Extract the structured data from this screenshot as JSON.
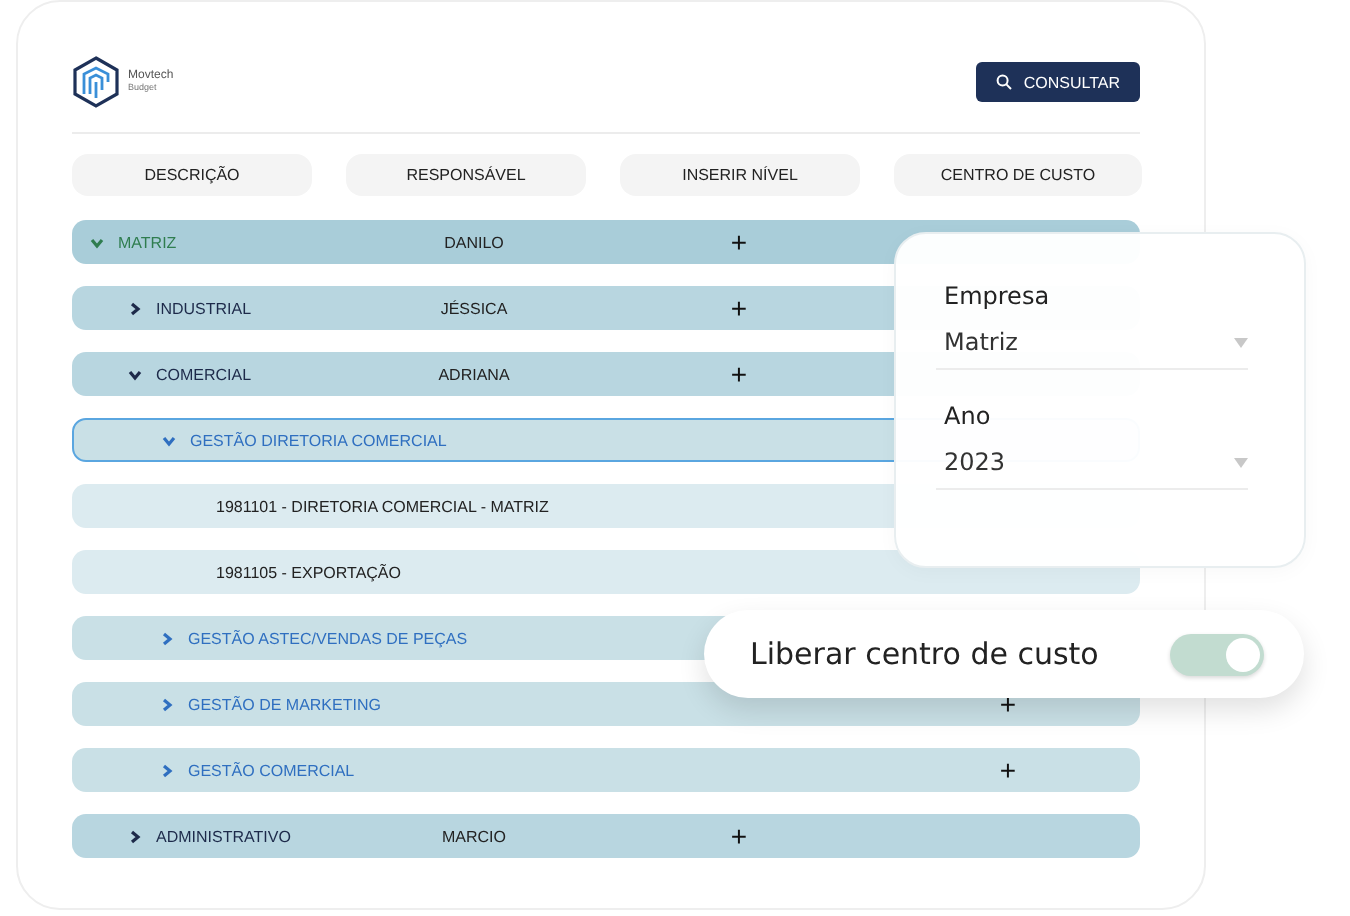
{
  "logo": {
    "name": "Movtech",
    "product": "Budget"
  },
  "search_button": {
    "label": "CONSULTAR"
  },
  "columns": [
    "DESCRIÇÃO",
    "RESPONSÁVEL",
    "INSERIR NÍVEL",
    "CENTRO DE CUSTO"
  ],
  "tree": [
    {
      "label": "MATRIZ",
      "responsible": "DANILO",
      "insert": "+",
      "expanded": true,
      "selected": false,
      "children": [
        {
          "label": "INDUSTRIAL",
          "responsible": "JÉSSICA",
          "insert": "+",
          "expanded": false,
          "selected": false
        },
        {
          "label": "COMERCIAL",
          "responsible": "ADRIANA",
          "insert": "+",
          "expanded": true,
          "selected": false,
          "children": [
            {
              "label": "GESTÃO DIRETORIA COMERCIAL",
              "expanded": true,
              "selected": true,
              "children": [
                {
                  "label": "1981101 - DIRETORIA COMERCIAL - MATRIZ",
                  "selected": false
                },
                {
                  "label": "1981105 - EXPORTAÇÃO",
                  "selected": false
                }
              ]
            },
            {
              "label": "GESTÃO ASTEC/VENDAS DE PEÇAS",
              "expanded": false,
              "selected": false
            },
            {
              "label": "GESTÃO DE MARKETING",
              "cost_center": "+",
              "expanded": false,
              "selected": false
            },
            {
              "label": "GESTÃO COMERCIAL",
              "cost_center": "+",
              "expanded": false,
              "selected": false
            }
          ]
        },
        {
          "label": "ADMINISTRATIVO",
          "responsible": "MARCIO",
          "insert": "+",
          "expanded": false,
          "selected": false
        }
      ]
    }
  ],
  "filter_panel": {
    "fields": [
      {
        "label": "Empresa",
        "value": "Matriz"
      },
      {
        "label": "Ano",
        "value": "2023"
      }
    ]
  },
  "toggle": {
    "label": "Liberar centro de custo",
    "on": true
  }
}
